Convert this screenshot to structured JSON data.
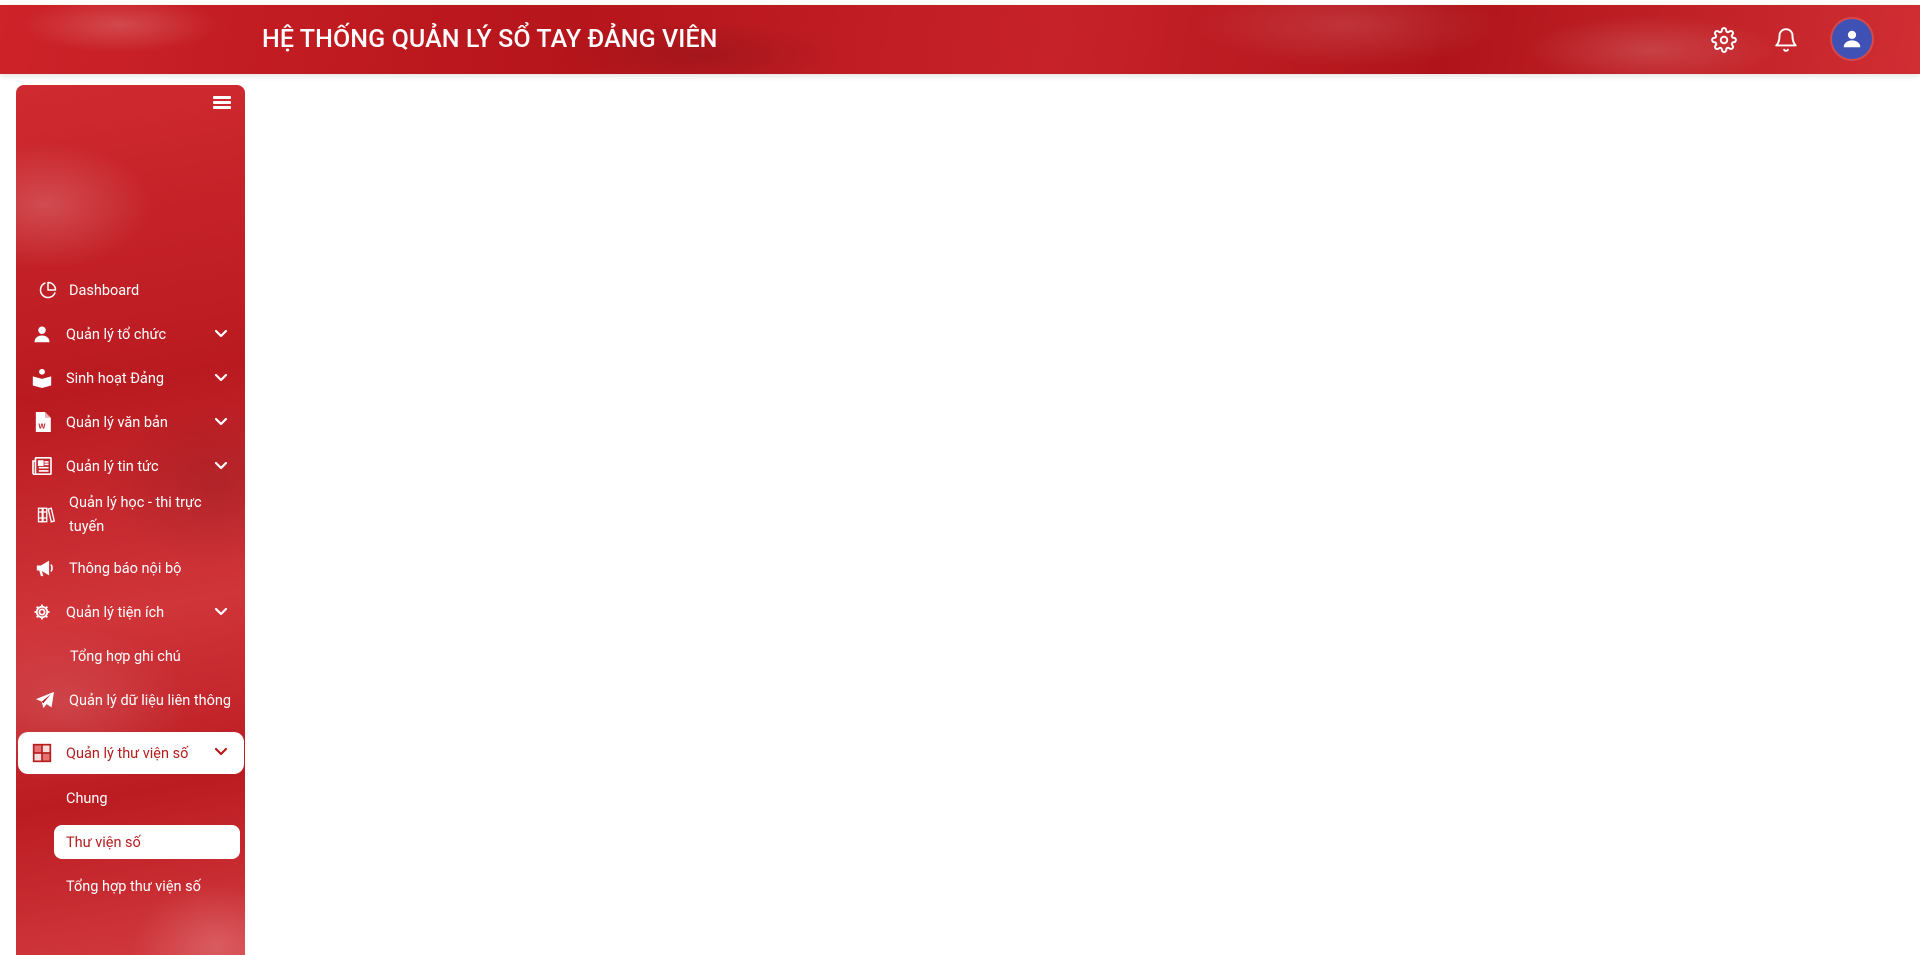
{
  "header": {
    "title": "HỆ THỐNG QUẢN LÝ SỔ TAY ĐẢNG VIÊN",
    "settings_icon": "gear-icon",
    "notification_icon": "bell-icon",
    "avatar_icon": "user-icon"
  },
  "sidebar": {
    "toggle_icon": "hamburger-icon",
    "items": [
      {
        "label": "Dashboard",
        "icon": "pie-chart-icon",
        "expandable": false
      },
      {
        "label": "Quản lý tổ chức",
        "icon": "user-icon",
        "expandable": true
      },
      {
        "label": "Sinh hoạt Đảng",
        "icon": "reading-person-icon",
        "expandable": true
      },
      {
        "label": "Quản lý văn bản",
        "icon": "word-document-icon",
        "expandable": true
      },
      {
        "label": "Quản lý tin tức",
        "icon": "newspaper-icon",
        "expandable": true
      },
      {
        "label": "Quản lý học - thi trực tuyến",
        "icon": "library-books-icon",
        "expandable": false
      },
      {
        "label": "Thông báo nội bộ",
        "icon": "megaphone-icon",
        "expandable": false
      },
      {
        "label": "Quản lý tiện ích",
        "icon": "gear-icon",
        "expandable": true
      },
      {
        "label": "Tổng hợp ghi chú",
        "icon": "",
        "expandable": false
      },
      {
        "label": "Quản lý dữ liệu liên thông",
        "icon": "paper-plane-icon",
        "expandable": false
      },
      {
        "label": "Quản lý thư viện số",
        "icon": "digital-library-icon",
        "expandable": true,
        "active": true
      }
    ],
    "sub_items": [
      {
        "label": "Chung"
      },
      {
        "label": "Thư viện số",
        "active": true
      },
      {
        "label": "Tổng hợp thư viện số"
      }
    ]
  },
  "colors": {
    "brand_red": "#c41e25",
    "active_text": "#b71c1c",
    "avatar_bg": "#3f51b5"
  }
}
